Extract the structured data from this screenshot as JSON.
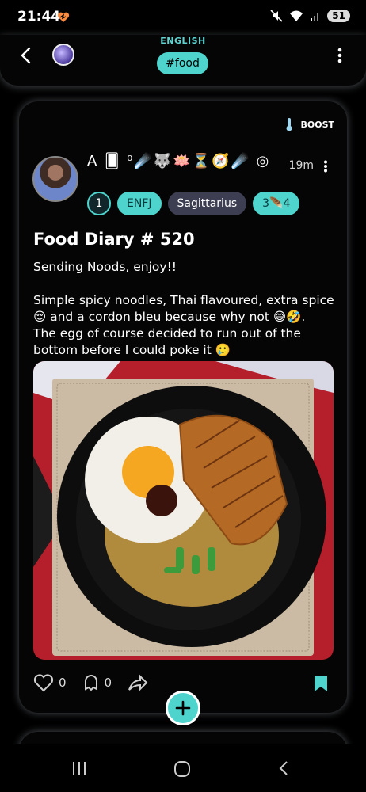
{
  "status": {
    "time": "21:44",
    "battery": "51"
  },
  "header": {
    "language": "ENGLISH",
    "tag": "#food"
  },
  "post": {
    "boost_label": "BOOST",
    "author_display": "A 🂠 ⁰☄️🐺🪷⏳🧭☄️ ◎",
    "time_ago": "19m",
    "badges": {
      "level": "1",
      "mbti": "ENFJ",
      "zodiac": "Sagittarius",
      "coins": "3🪶4"
    },
    "title": "Food Diary # 520",
    "body": "Sending Noods, enjoy!!\n\nSimple spicy noodles, Thai flavoured, extra spice 😌 and a cordon bleu because why not 😅🤣.\nThe egg of course decided to run out of the bottom before I could poke it 🥲",
    "likes": "0",
    "comments": "0"
  },
  "colors": {
    "accent": "#4ed4cd",
    "zodiac_badge": "#3d3e52"
  },
  "icons": [
    "back-arrow-icon",
    "more-vert-icon",
    "thermometer-icon",
    "heart-icon",
    "comment-bubble-icon",
    "share-arrow-icon",
    "bookmark-icon",
    "plus-icon"
  ]
}
